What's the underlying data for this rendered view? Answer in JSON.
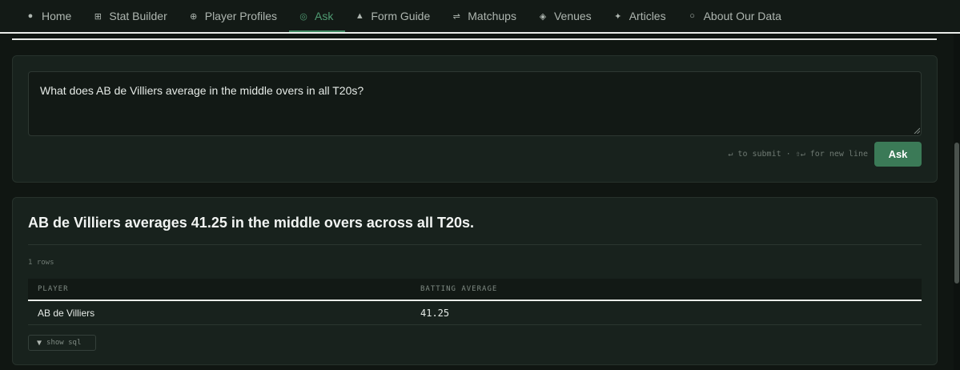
{
  "nav": {
    "items": [
      {
        "label": "Home",
        "icon": "●",
        "active": false
      },
      {
        "label": "Stat Builder",
        "icon": "⊞",
        "active": false
      },
      {
        "label": "Player Profiles",
        "icon": "⊕",
        "active": false
      },
      {
        "label": "Ask",
        "icon": "◎",
        "active": true
      },
      {
        "label": "Form Guide",
        "icon": "▲",
        "active": false
      },
      {
        "label": "Matchups",
        "icon": "⇌",
        "active": false
      },
      {
        "label": "Venues",
        "icon": "◈",
        "active": false
      },
      {
        "label": "Articles",
        "icon": "✦",
        "active": false
      },
      {
        "label": "About Our Data",
        "icon": "○",
        "active": false
      }
    ]
  },
  "ask": {
    "question": "What does AB de Villiers average in the middle overs in all T20s?",
    "hint": "↵ to submit · ⇧↵ for new line",
    "submit_label": "Ask"
  },
  "answer": {
    "title_prefix": "AB de Villiers averages ",
    "title_value": "41.25",
    "title_suffix": " in the middle overs across all T20s.",
    "rows_count": "1 rows",
    "columns": [
      "Player",
      "Batting Average"
    ],
    "rows": [
      [
        "AB de Villiers",
        "41.25"
      ]
    ],
    "show_sql_label": "show sql",
    "show_sql_icon": "▼"
  },
  "colors": {
    "accent": "#3b7a57",
    "active_nav": "#4f9b72",
    "background": "#101612",
    "panel": "#18221d"
  }
}
